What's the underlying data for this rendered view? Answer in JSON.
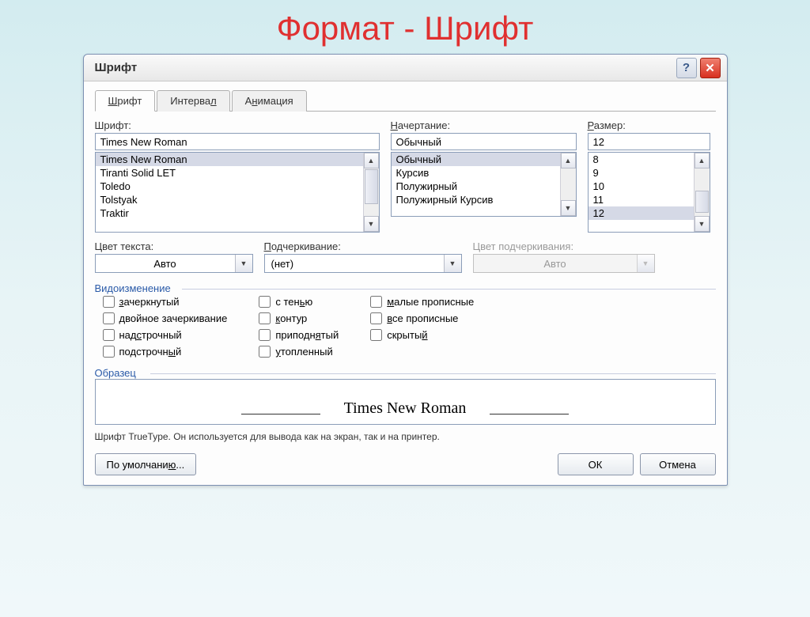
{
  "slide_title": "Формат - Шрифт",
  "dialog": {
    "title": "Шрифт",
    "tabs": [
      "Шрифт",
      "Интервал",
      "Анимация"
    ],
    "font": {
      "label": "Шрифт:",
      "value": "Times New Roman",
      "options": [
        "Times New Roman",
        "Tiranti Solid LET",
        "Toledo",
        "Tolstyak",
        "Traktir"
      ]
    },
    "style": {
      "label": "Начертание:",
      "value": "Обычный",
      "options": [
        "Обычный",
        "Курсив",
        "Полужирный",
        "Полужирный Курсив"
      ]
    },
    "size": {
      "label": "Размер:",
      "value": "12",
      "options": [
        "8",
        "9",
        "10",
        "11",
        "12"
      ]
    },
    "text_color": {
      "label": "Цвет текста:",
      "value": "Авто"
    },
    "underline": {
      "label": "Подчеркивание:",
      "value": "(нет)"
    },
    "underline_color": {
      "label": "Цвет подчеркивания:",
      "value": "Авто"
    },
    "effects": {
      "title": "Видоизменение",
      "col1": [
        "зачеркнутый",
        "двойное зачеркивание",
        "надстрочный",
        "подстрочный"
      ],
      "col2": [
        "с тенью",
        "контур",
        "приподнятый",
        "утопленный"
      ],
      "col3": [
        "малые прописные",
        "все прописные",
        "скрытый"
      ]
    },
    "preview": {
      "title": "Образец",
      "text": "Times New Roman"
    },
    "hint": "Шрифт TrueType. Он используется для вывода как на экран, так и на принтер.",
    "buttons": {
      "default": "По умолчанию...",
      "ok": "ОК",
      "cancel": "Отмена"
    }
  }
}
